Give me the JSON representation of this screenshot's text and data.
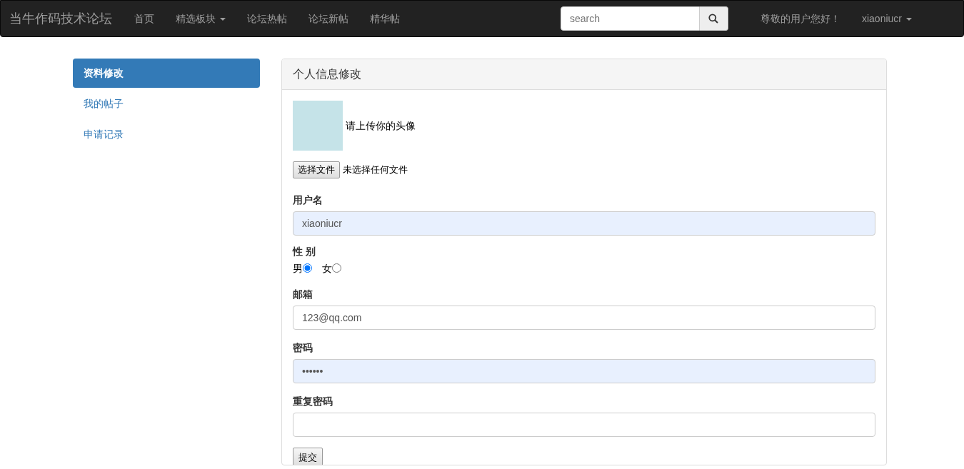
{
  "navbar": {
    "brand": "当牛作码技术论坛",
    "links": [
      {
        "label": "首页",
        "dropdown": false
      },
      {
        "label": "精选板块",
        "dropdown": true
      },
      {
        "label": "论坛热帖",
        "dropdown": false
      },
      {
        "label": "论坛新帖",
        "dropdown": false
      },
      {
        "label": "精华帖",
        "dropdown": false
      }
    ],
    "search": {
      "placeholder": "search"
    },
    "greeting": "尊敬的用户您好！",
    "user_menu": "xiaoniucr"
  },
  "sidebar": {
    "items": [
      {
        "label": "资料修改",
        "selected": true
      },
      {
        "label": "我的帖子",
        "selected": false
      },
      {
        "label": "申请记录",
        "selected": false
      }
    ]
  },
  "panel": {
    "title": "个人信息修改",
    "avatar_caption": "请上传你的头像",
    "file_button": "选择文件",
    "file_status": "未选择任何文件",
    "fields": [
      {
        "kind": "text",
        "label": "用户名",
        "value": "xiaoniucr",
        "autofilled": true
      },
      {
        "kind": "radio",
        "label": "性 别",
        "options": [
          {
            "label": "男",
            "selected": true
          },
          {
            "label": "女",
            "selected": false
          }
        ]
      },
      {
        "kind": "text",
        "label": "邮箱",
        "value": "123@qq.com",
        "autofilled": false
      },
      {
        "kind": "text",
        "label": "密码",
        "value": "••••••",
        "autofilled": true
      },
      {
        "kind": "text",
        "label": "重复密码",
        "autofilled": false
      }
    ],
    "submit": "提交"
  }
}
